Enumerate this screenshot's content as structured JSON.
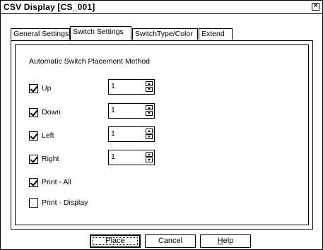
{
  "window": {
    "title": "CSV Display [CS_001]",
    "close_glyph": "×"
  },
  "tabs": [
    {
      "label": "General Settings",
      "active": false
    },
    {
      "label": "Switch Settings",
      "active": true
    },
    {
      "label": "SwitchType/Color",
      "active": false
    },
    {
      "label": "Extend",
      "active": false
    }
  ],
  "panel": {
    "group_label": "Automatic Switch Placement Method",
    "rows": [
      {
        "label": "Up",
        "checked": true,
        "value": "1"
      },
      {
        "label": "Down",
        "checked": true,
        "value": "1"
      },
      {
        "label": "Left",
        "checked": true,
        "value": "1"
      },
      {
        "label": "Right",
        "checked": true,
        "value": "1"
      }
    ],
    "print_all": {
      "label": "Print - All",
      "checked": true
    },
    "print_display": {
      "label": "Print - Display",
      "checked": false
    }
  },
  "buttons": {
    "place": "Place",
    "cancel": "Cancel",
    "help_prefix": "H",
    "help_rest": "elp"
  }
}
